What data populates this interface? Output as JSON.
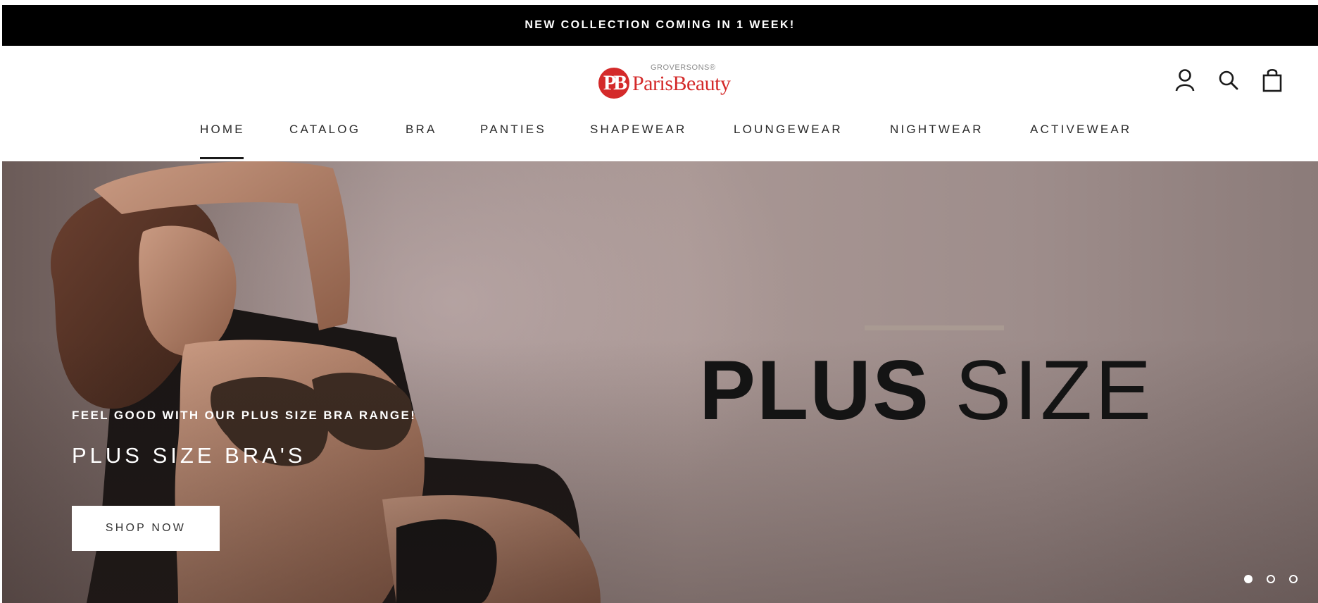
{
  "announcement": {
    "text": "NEW COLLECTION COMING IN 1 WEEK!"
  },
  "brand": {
    "mark": "PB",
    "sub": "GROVERSONS®",
    "name": "ParisBeauty",
    "brand_color": "#d42a2a"
  },
  "header_icons": [
    {
      "icon": "account-icon"
    },
    {
      "icon": "search-icon"
    },
    {
      "icon": "cart-icon"
    }
  ],
  "nav": {
    "items": [
      {
        "label": "HOME",
        "active": true
      },
      {
        "label": "CATALOG"
      },
      {
        "label": "BRA"
      },
      {
        "label": "PANTIES"
      },
      {
        "label": "SHAPEWEAR"
      },
      {
        "label": "LOUNGEWEAR"
      },
      {
        "label": "NIGHTWEAR"
      },
      {
        "label": "ACTIVEWEAR"
      }
    ]
  },
  "hero": {
    "display_bold": "PLUS",
    "display_light": "SIZE",
    "eyebrow": "FEEL GOOD WITH OUR PLUS SIZE BRA RANGE!",
    "heading": "PLUS SIZE BRA'S",
    "cta": "SHOP NOW",
    "slides": {
      "count": 3,
      "active": 1
    }
  }
}
